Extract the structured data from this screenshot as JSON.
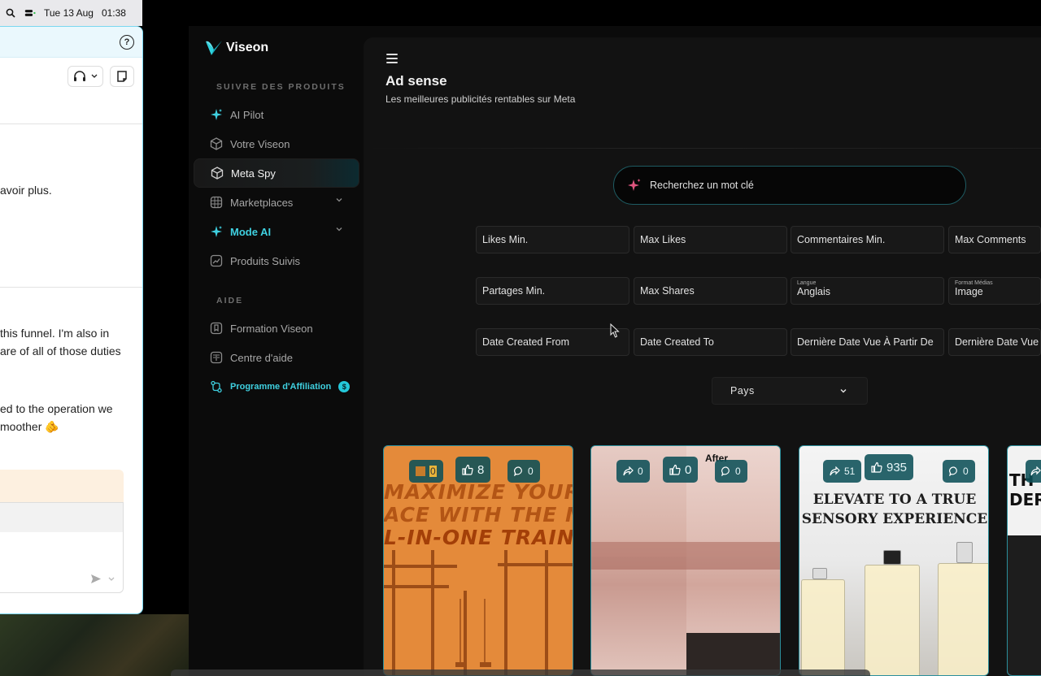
{
  "menubar": {
    "date": "Tue 13 Aug",
    "time": "01:38"
  },
  "chat": {
    "messages": [
      "avoir plus.",
      "this funnel. I'm also in",
      "are of all of those duties",
      "ed to the operation we",
      "moother 🫵"
    ]
  },
  "app": {
    "brand": "Viseon",
    "sidebar": {
      "section_products": "SUIVRE DES PRODUITS",
      "items": [
        {
          "label": "AI Pilot"
        },
        {
          "label": "Votre Viseon"
        },
        {
          "label": "Meta Spy"
        },
        {
          "label": "Marketplaces"
        },
        {
          "label": "Mode AI"
        },
        {
          "label": "Produits Suivis"
        }
      ],
      "section_help": "AIDE",
      "help_items": [
        {
          "label": "Formation Viseon"
        },
        {
          "label": "Centre d'aide"
        },
        {
          "label": "Programme d'Affiliation",
          "badge": "$"
        }
      ]
    },
    "main": {
      "title": "Ad sense",
      "subtitle": "Les meilleures publicités rentables sur Meta",
      "search_placeholder": "Recherchez un mot clé",
      "filters": {
        "row1": [
          "Likes Min.",
          "Max Likes",
          "Commentaires Min.",
          "Max Comments"
        ],
        "row2": [
          {
            "label": "Partages Min."
          },
          {
            "label": "Max Shares"
          },
          {
            "caption": "Langue",
            "value": "Anglais"
          },
          {
            "caption": "Format Médias",
            "value": "Image"
          }
        ],
        "row3": [
          "Date Created From",
          "Date Created To",
          "Dernière Date Vue À Partir De",
          "Dernière Date Vue"
        ]
      },
      "country_select": "Pays",
      "cards": [
        {
          "shares": "0",
          "likes": "8",
          "comments": "0",
          "lines": [
            "MAXIMIZE YOUR",
            "ACE WITH THE M",
            "L-IN-ONE TRAIN"
          ]
        },
        {
          "shares": "0",
          "likes": "0",
          "comments": "0",
          "overlay": "After"
        },
        {
          "shares": "51",
          "likes": "935",
          "comments": "0",
          "lines": [
            "ELEVATE TO A TRUE",
            "SENSORY EXPERIENCE"
          ]
        },
        {
          "lines": [
            "TH",
            "DER"
          ]
        }
      ]
    }
  },
  "colors": {
    "accent": "#3fd0e0",
    "card_border": "#2b8f9c",
    "stat_bg": "#0c5058"
  }
}
